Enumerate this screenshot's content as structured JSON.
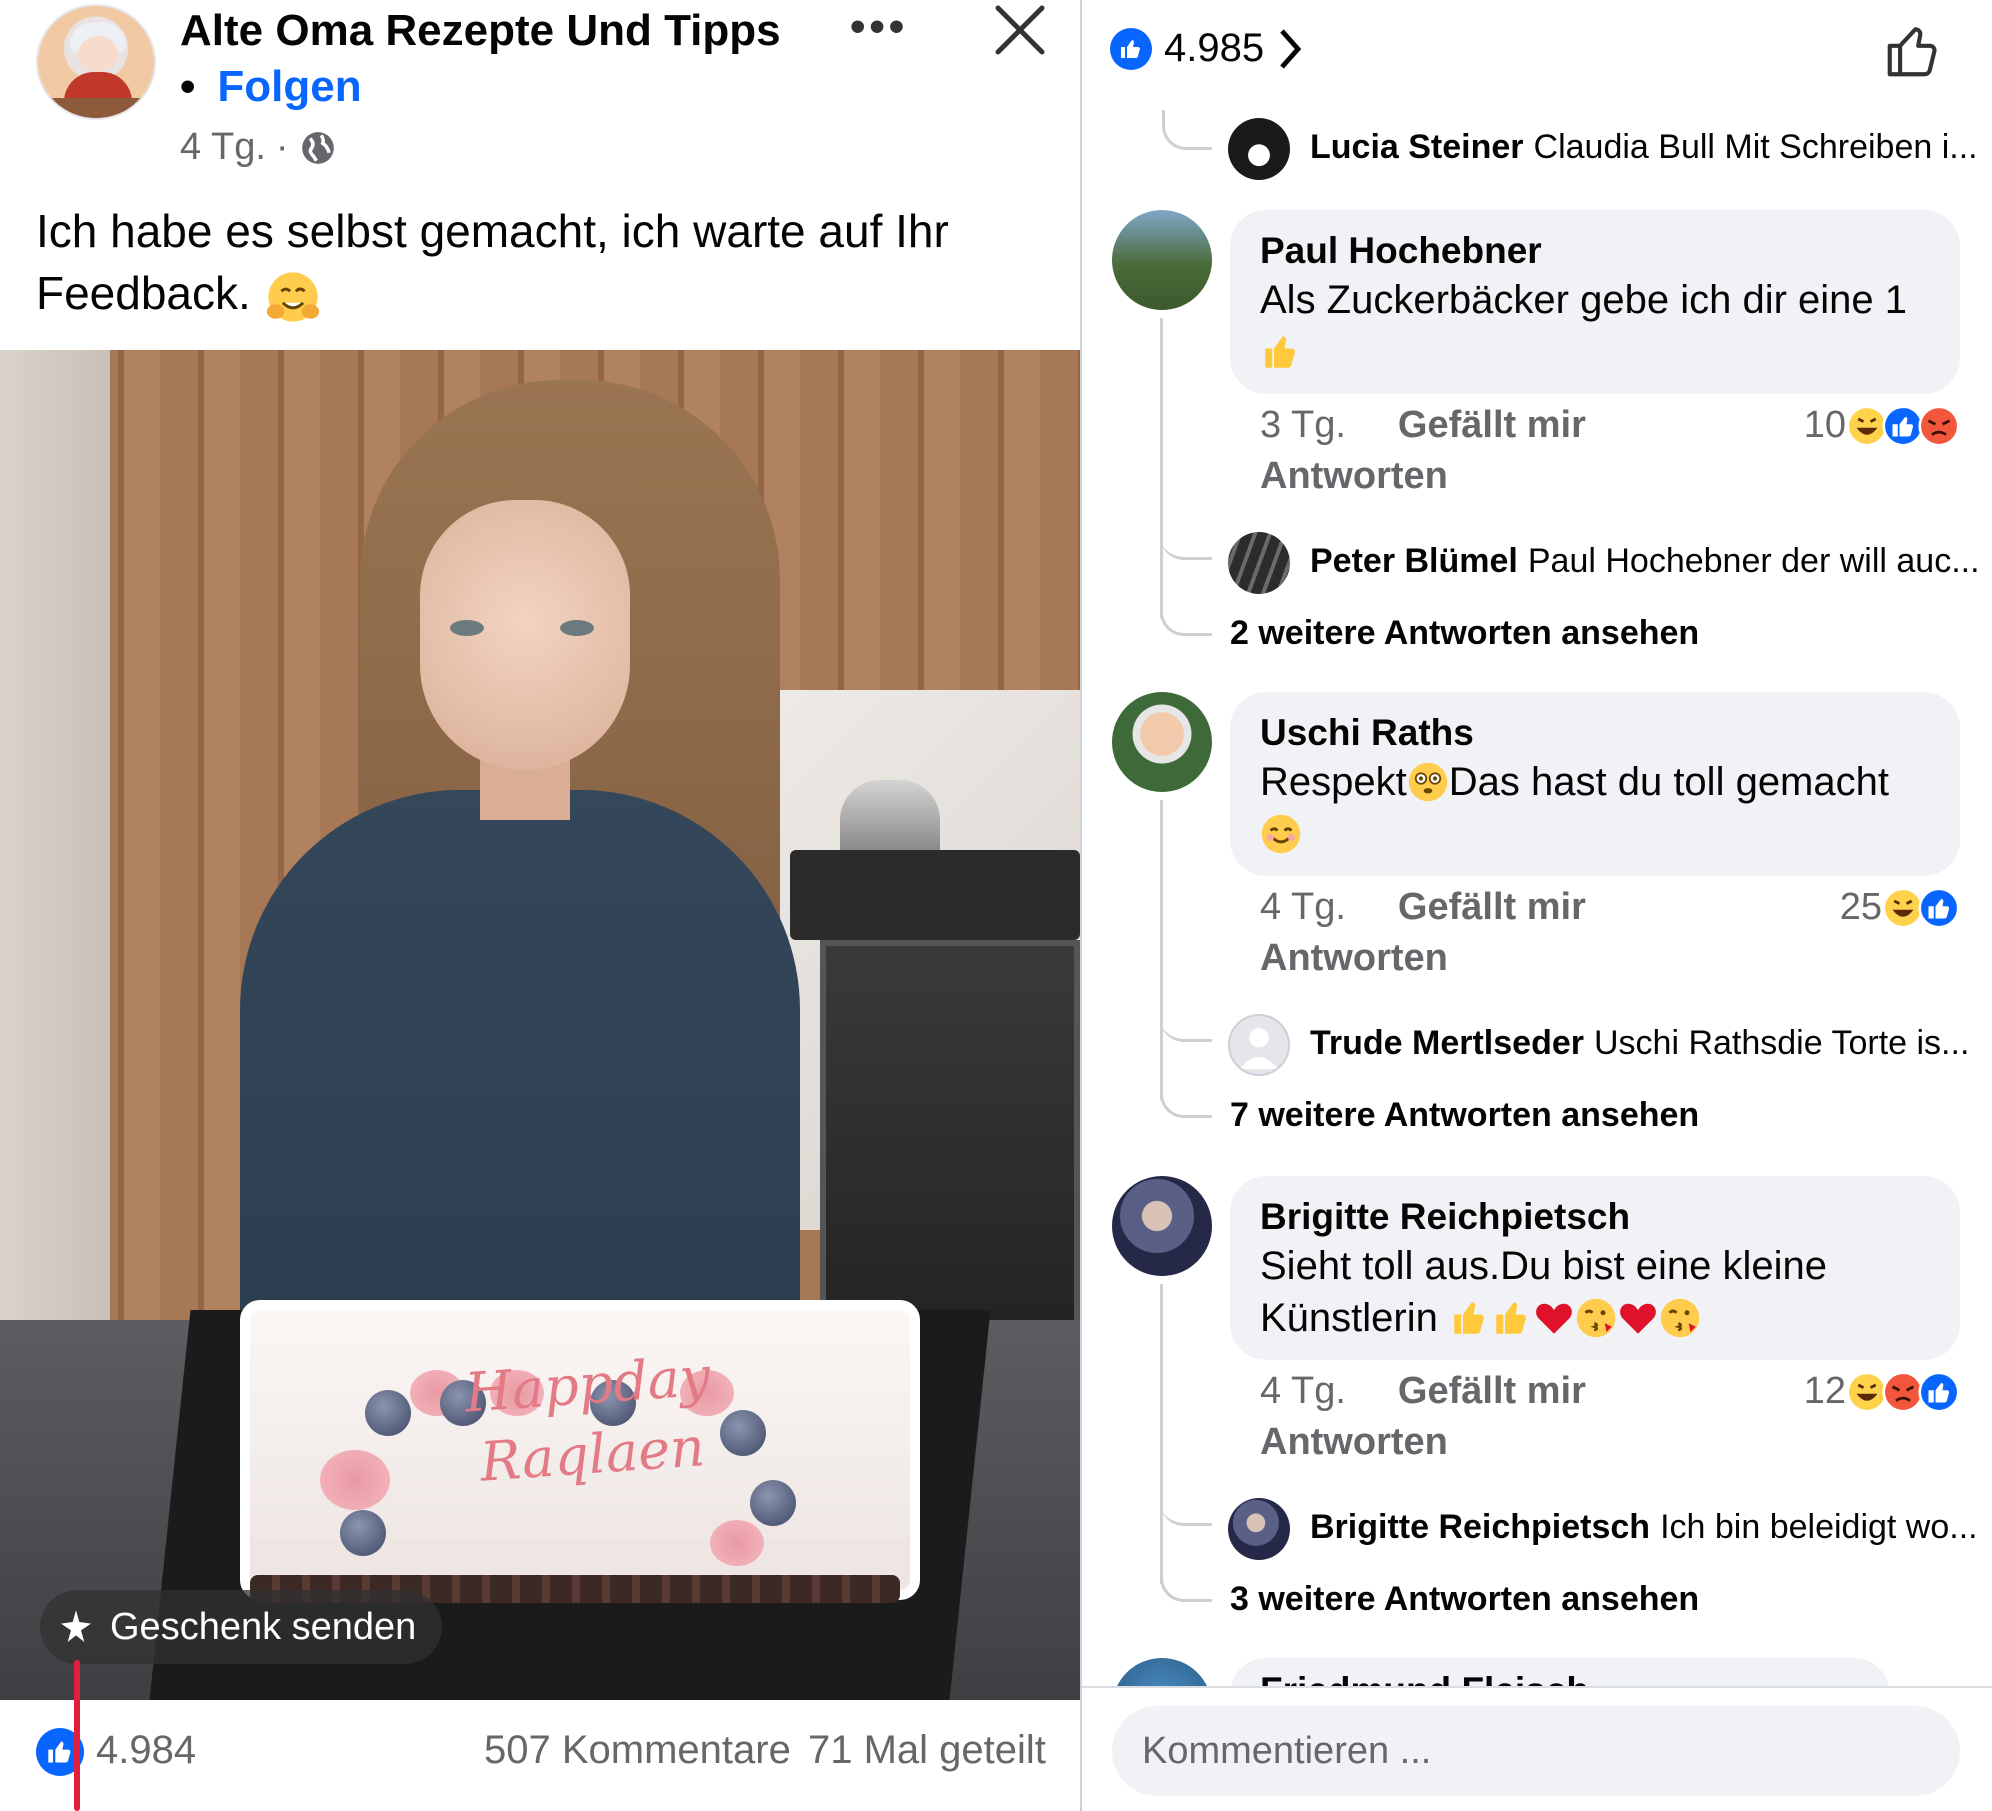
{
  "post": {
    "page_name": "Alte Oma Rezepte Und Tipps",
    "follow_separator": "•",
    "follow_label": "Folgen",
    "time": "4 Tg.",
    "meta_separator": "·",
    "text": "Ich habe es selbst gemacht, ich warte auf Ihr Feedback.",
    "more_label": "•••",
    "image_cake_text": "Happday Raqlaen",
    "gift_label": "Geschenk senden",
    "likes": "4.984",
    "comments": "507 Kommentare",
    "shares": "71 Mal geteilt"
  },
  "comments_panel": {
    "reaction_count": "4.985",
    "reply_lucia": {
      "name": "Lucia Steiner",
      "text": "Claudia Bull Mit Schreiben i..."
    },
    "comments": [
      {
        "name": "Paul Hochebner",
        "text": "Als Zuckerbäcker gebe ich dir eine 1",
        "time": "3 Tg.",
        "like_label": "Gefällt mir",
        "reply_label": "Antworten",
        "reaction_count": "10",
        "reactions": [
          "haha",
          "like",
          "angry"
        ],
        "reply": {
          "name": "Peter Blümel",
          "text": "Paul Hochebner der will auc..."
        },
        "more_replies": "2 weitere Antworten ansehen"
      },
      {
        "name": "Uschi Raths",
        "text_before_emoji": "Respekt",
        "text_after_emoji": "Das hast du toll gemacht",
        "time": "4 Tg.",
        "like_label": "Gefällt mir",
        "reply_label": "Antworten",
        "reaction_count": "25",
        "reactions": [
          "haha",
          "like"
        ],
        "reply": {
          "name": "Trude Mertlseder",
          "text": "Uschi Rathsdie Torte is..."
        },
        "more_replies": "7 weitere Antworten ansehen"
      },
      {
        "name": "Brigitte Reichpietsch",
        "text_line1": "Sieht toll aus.Du bist eine kleine",
        "text_line2": "Künstlerin",
        "time": "4 Tg.",
        "like_label": "Gefällt mir",
        "reply_label": "Antworten",
        "reaction_count": "12",
        "reactions": [
          "haha",
          "angry",
          "like"
        ],
        "reply": {
          "name": "Brigitte Reichpietsch",
          "text": "Ich bin beleidigt wo..."
        },
        "more_replies": "3 weitere Antworten ansehen"
      }
    ],
    "partial_comment_name": "Friedmund Fleisch",
    "composer_placeholder": "Kommentieren ..."
  },
  "colors": {
    "facebook_blue": "#0866ff",
    "secondary_text": "#65676b",
    "bubble_bg": "#f0f2f5",
    "annotation_red": "#e41e3f"
  }
}
